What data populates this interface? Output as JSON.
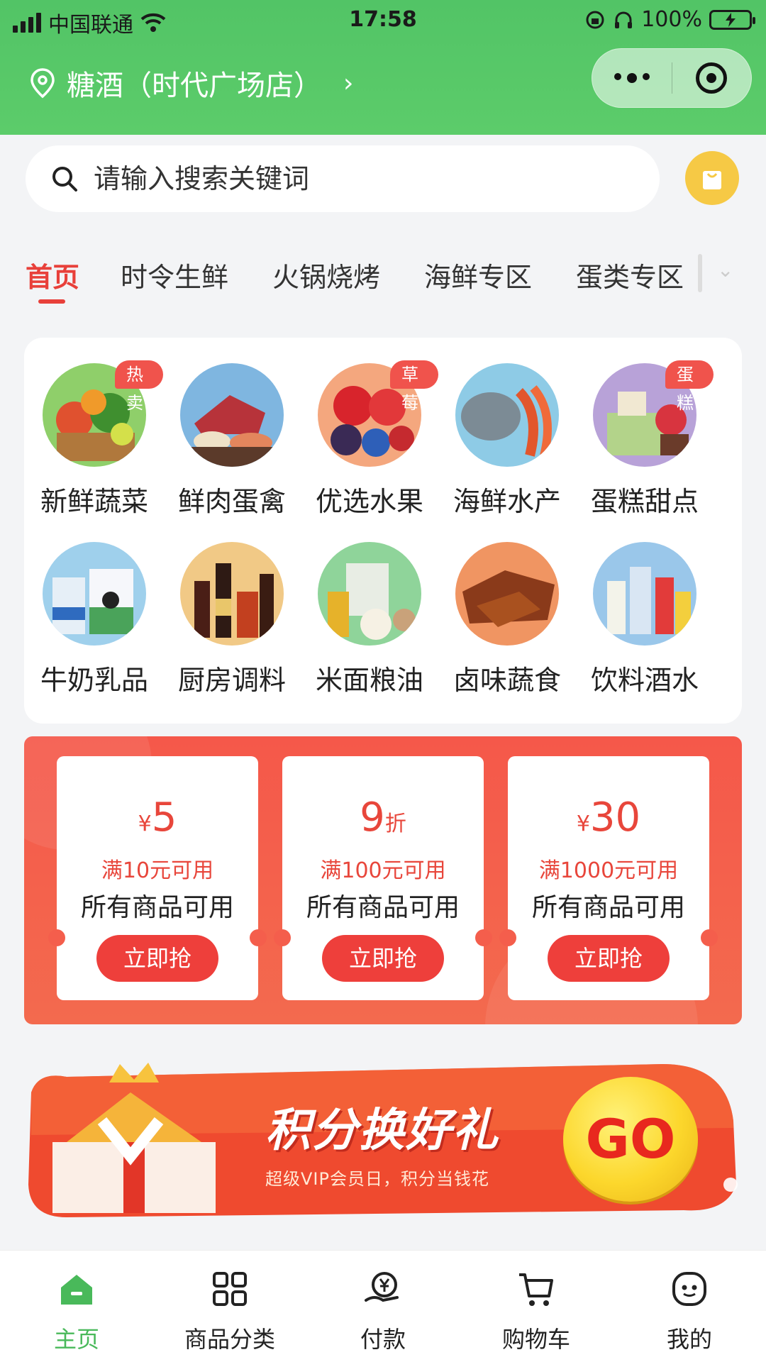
{
  "status_bar": {
    "carrier": "中国联通",
    "time": "17:58",
    "battery": "100%"
  },
  "header": {
    "store_name": "糖酒（时代广场店）",
    "chevron": "›",
    "brand_color": "#52c466"
  },
  "search": {
    "placeholder": "请输入搜索关键词"
  },
  "tabs": [
    {
      "label": "首页",
      "active": true
    },
    {
      "label": "时令生鲜"
    },
    {
      "label": "火锅烧烤"
    },
    {
      "label": "海鲜专区"
    },
    {
      "label": "蛋类专区"
    }
  ],
  "categories": [
    {
      "label": "新鲜蔬菜",
      "badge": "热卖",
      "icon": "vegetables-image"
    },
    {
      "label": "鲜肉蛋禽",
      "icon": "meat-image"
    },
    {
      "label": "优选水果",
      "badge": "草莓",
      "icon": "fruit-image"
    },
    {
      "label": "海鲜水产",
      "icon": "seafood-image"
    },
    {
      "label": "蛋糕甜点",
      "badge": "蛋糕",
      "icon": "cake-image"
    },
    {
      "label": "牛奶乳品",
      "icon": "milk-image"
    },
    {
      "label": "厨房调料",
      "icon": "condiments-image"
    },
    {
      "label": "米面粮油",
      "icon": "grain-oil-image"
    },
    {
      "label": "卤味蔬食",
      "icon": "braised-food-image"
    },
    {
      "label": "饮料酒水",
      "icon": "drinks-image"
    }
  ],
  "coupons": [
    {
      "prefix": "¥",
      "value": "5",
      "suffix": "",
      "condition": "满10元可用",
      "scope": "所有商品可用",
      "button": "立即抢"
    },
    {
      "prefix": "",
      "value": "9",
      "suffix": "折",
      "condition": "满100元可用",
      "scope": "所有商品可用",
      "button": "立即抢"
    },
    {
      "prefix": "¥",
      "value": "30",
      "suffix": "",
      "condition": "满1000元可用",
      "scope": "所有商品可用",
      "button": "立即抢"
    }
  ],
  "promo_banner": {
    "title": "积分换好礼",
    "subtitle": "超级VIP会员日，积分当钱花",
    "go": "GO"
  },
  "bottom_nav": [
    {
      "label": "主页",
      "icon": "home-icon",
      "active": true
    },
    {
      "label": "商品分类",
      "icon": "grid-icon"
    },
    {
      "label": "付款",
      "icon": "yen-pay-icon"
    },
    {
      "label": "购物车",
      "icon": "cart-icon"
    },
    {
      "label": "我的",
      "icon": "smiley-icon"
    }
  ],
  "colors": {
    "accent_red": "#e8403a",
    "active_green": "#49b95a",
    "bag_yellow": "#f6c945"
  }
}
